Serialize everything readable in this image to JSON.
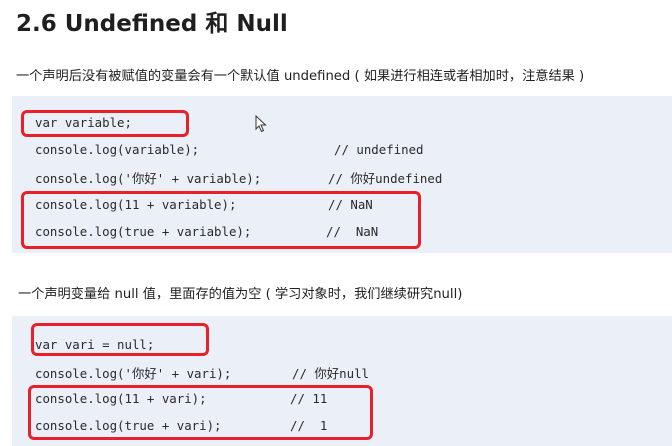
{
  "title": "2.6  Undefined  和  Null",
  "section1": {
    "description": "一个声明后没有被赋值的变量会有一个默认值 undefined ( 如果进行相连或者相加时，注意结果 )",
    "lines": [
      {
        "code": "var variable;",
        "comment": ""
      },
      {
        "code": "console.log(variable);",
        "comment": "// undefined"
      },
      {
        "code": "console.log('你好' + variable);",
        "comment": "// 你好undefined"
      },
      {
        "code": "console.log(11 + variable);",
        "comment": "// NaN"
      },
      {
        "code": "console.log(true + variable);",
        "comment": "//  NaN"
      }
    ]
  },
  "section2": {
    "description": "一个声明变量给 null 值，里面存的值为空 ( 学习对象时，我们继续研究null)",
    "lines": [
      {
        "code": "var vari = null;",
        "comment": ""
      },
      {
        "code": "console.log('你好' + vari);",
        "comment": "// 你好null"
      },
      {
        "code": "console.log(11 + vari);",
        "comment": "// 11"
      },
      {
        "code": "console.log(true + vari);",
        "comment": "//  1"
      }
    ]
  },
  "colors": {
    "highlight": "#e8202a",
    "code_background": "#ebeff7"
  },
  "icons": {
    "cursor": "mouse-pointer-icon"
  }
}
